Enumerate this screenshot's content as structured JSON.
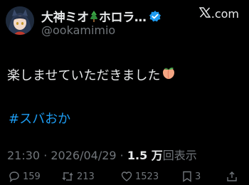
{
  "author": {
    "display_name": "大神ミオ",
    "display_name_suffix": "ホロラ…",
    "handle": "@ookamimio",
    "verified": true
  },
  "brand": {
    "label": ".com",
    "icon": "x-logo-icon"
  },
  "tweet": {
    "text": "楽しませていただきました",
    "emoji": "peach-icon",
    "hashtag": "#スバおか"
  },
  "meta": {
    "time": "21:30",
    "separator": " · ",
    "date": "2026/04/29",
    "views_count": "1.5 万",
    "views_label": "回表示"
  },
  "actions": {
    "reply_count": "159",
    "retweet_count": "213",
    "like_count": "1523",
    "bookmark_count": "3"
  },
  "colors": {
    "background": "#000000",
    "text": "#e7e9ea",
    "secondary": "#71767b",
    "accent": "#1d9bf0"
  }
}
